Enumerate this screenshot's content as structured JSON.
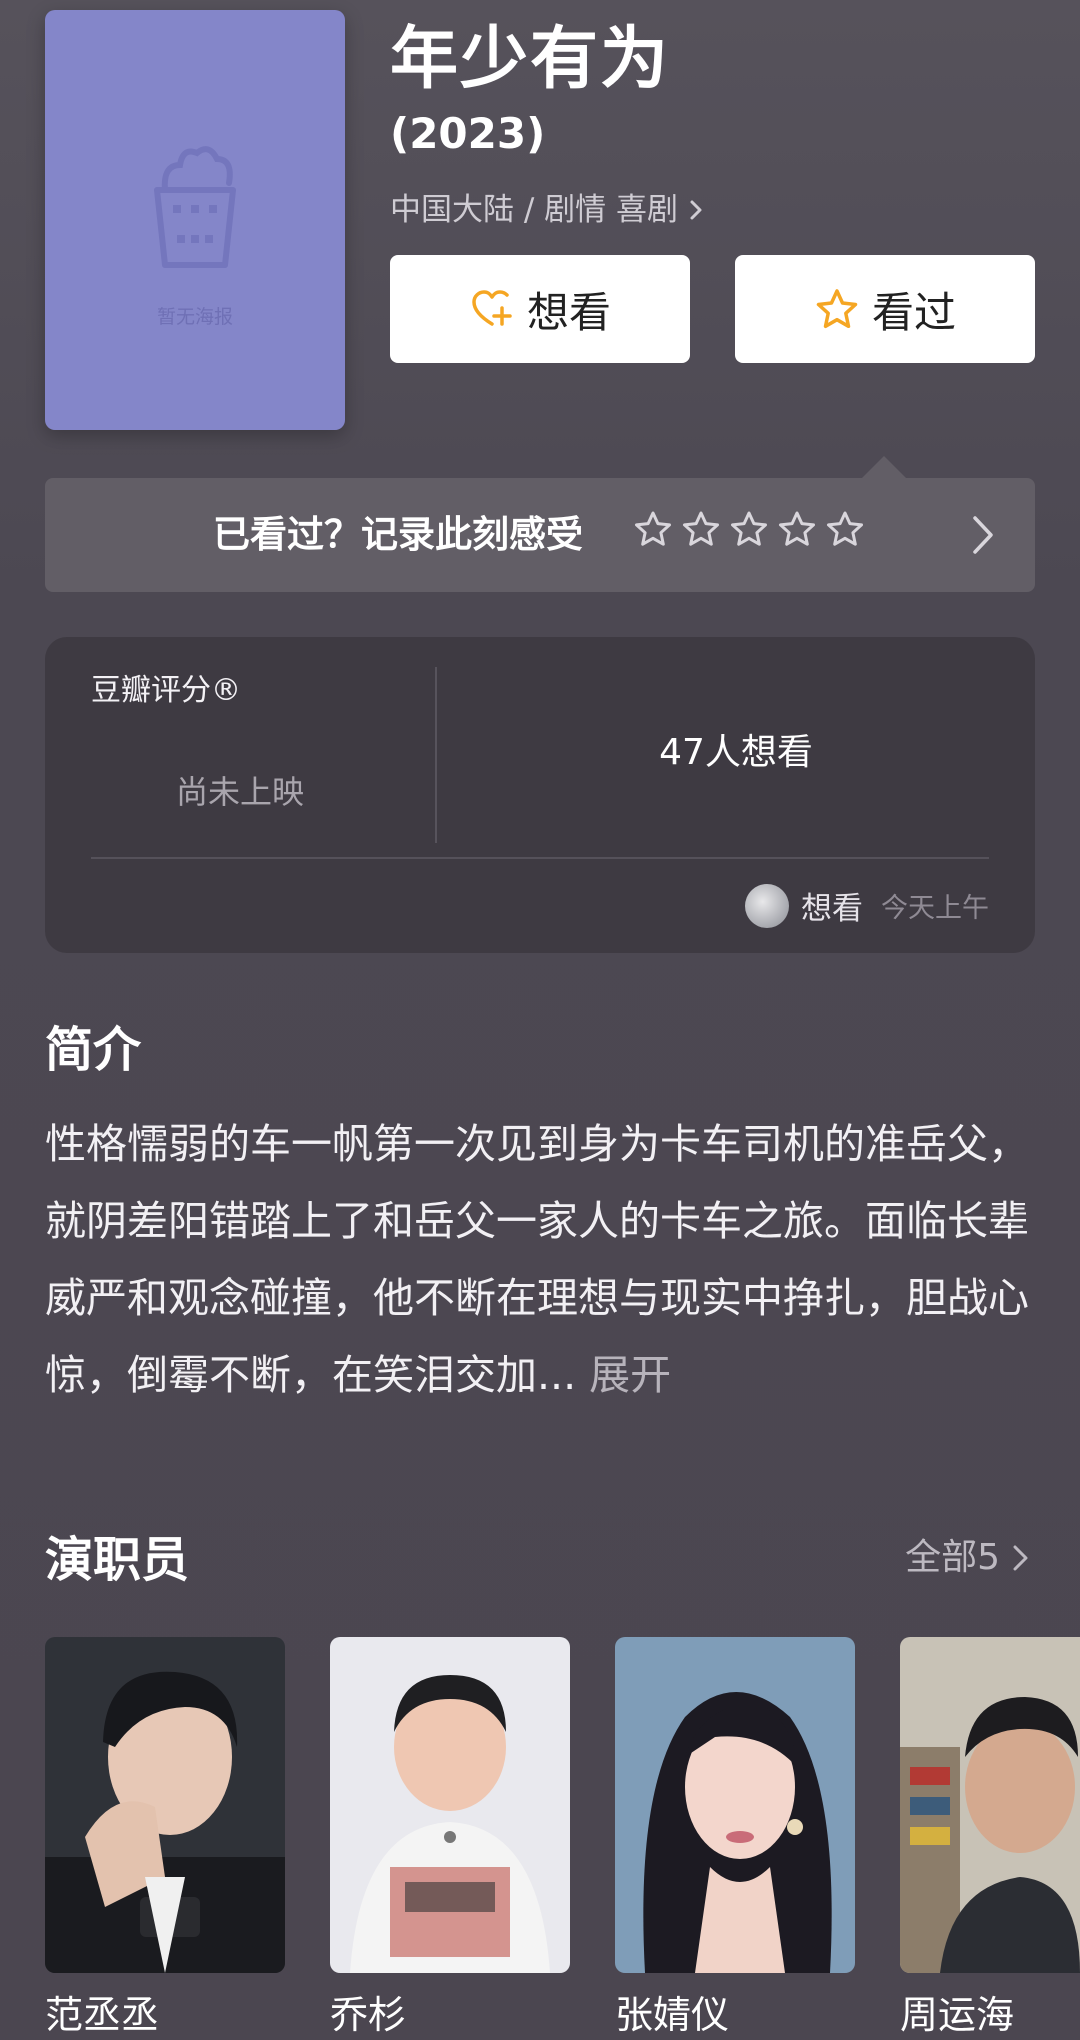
{
  "movie": {
    "title": "年少有为",
    "year": "(2023)",
    "genre": "中国大陆 / 剧情 喜剧",
    "poster_placeholder": "暂无海报"
  },
  "actions": {
    "want_label": "想看",
    "seen_label": "看过"
  },
  "record_bar": {
    "prompt": "已看过？记录此刻感受",
    "stars": 5
  },
  "rating": {
    "label": "豆瓣评分®",
    "status": "尚未上映",
    "want_count": "47人想看",
    "activity_label": "想看",
    "activity_time": "今天上午"
  },
  "intro": {
    "title": "简介",
    "text": "性格懦弱的车一帆第一次见到身为卡车司机的准岳父，就阴差阳错踏上了和岳父一家人的卡车之旅。面临长辈威严和观念碰撞，他不断在理想与现实中挣扎，胆战心惊，倒霉不断，在笑泪交加...",
    "expand_label": "展开"
  },
  "cast": {
    "title": "演职员",
    "all_label": "全部5",
    "members": [
      {
        "name": "范丞丞"
      },
      {
        "name": "乔杉"
      },
      {
        "name": "张婧仪"
      },
      {
        "name": "周运海"
      }
    ]
  },
  "colors": {
    "background": "#4b4650",
    "poster": "#8486c9",
    "accent_star": "#f5a623",
    "card": "#3e3a42"
  }
}
